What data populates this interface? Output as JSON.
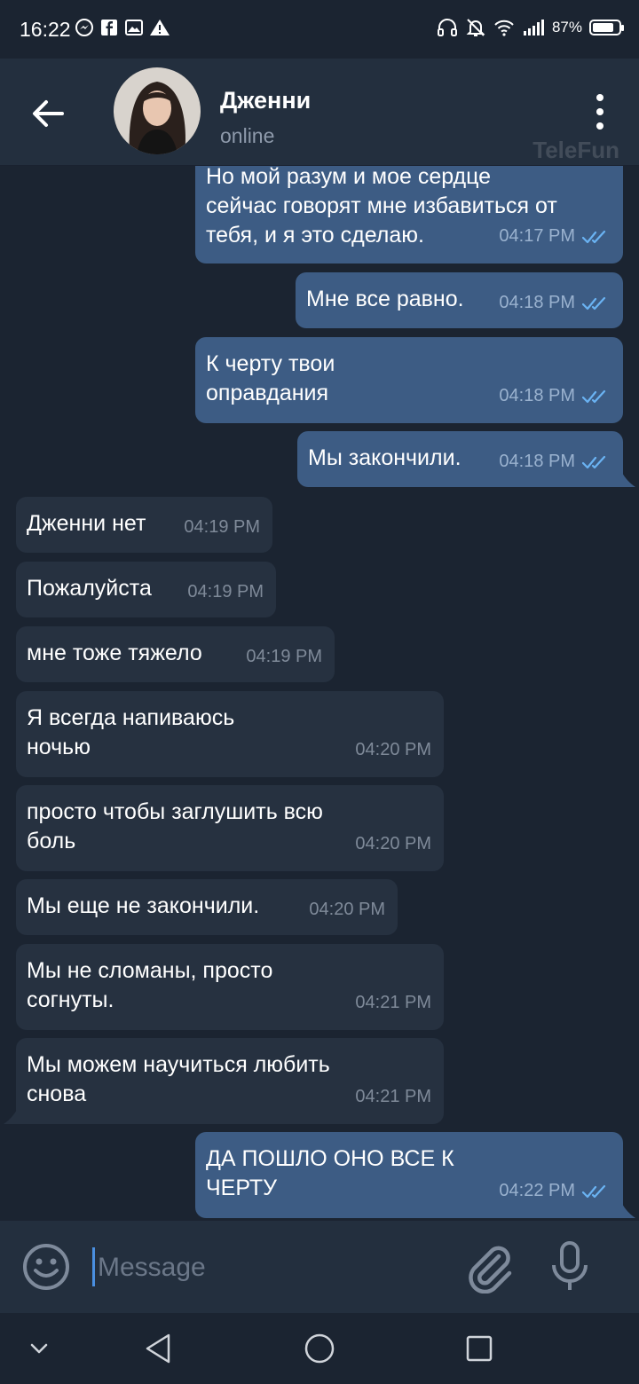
{
  "status_bar": {
    "time": "16:22",
    "battery_percent_text": "87%",
    "battery_level": 0.87,
    "left_icons": [
      "messenger-icon",
      "facebook-icon",
      "gallery-icon",
      "warning-icon"
    ],
    "right_icons": [
      "headphones-icon",
      "mute-bell-icon",
      "wifi-icon",
      "signal-icon",
      "battery-icon"
    ]
  },
  "header": {
    "contact_name": "Дженни",
    "status": "online",
    "watermark": "TeleFun"
  },
  "messages": [
    {
      "dir": "out",
      "text": "Но мой разум и мое сердце\nсейчас говорят мне избавиться от\nтебя, и я это сделаю.",
      "time": "04:17 PM"
    },
    {
      "dir": "out",
      "text": "Мне все равно.",
      "time": "04:18 PM"
    },
    {
      "dir": "out",
      "text": "К черту твои\nоправдания",
      "time": "04:18 PM"
    },
    {
      "dir": "out",
      "text": "Мы закончили.",
      "time": "04:18 PM"
    },
    {
      "dir": "in",
      "text": "Дженни нет",
      "time": "04:19 PM"
    },
    {
      "dir": "in",
      "text": "Пожалуйста",
      "time": "04:19 PM"
    },
    {
      "dir": "in",
      "text": "мне тоже тяжело",
      "time": "04:19 PM"
    },
    {
      "dir": "in",
      "text": "Я всегда напиваюсь\nночью",
      "time": "04:20 PM"
    },
    {
      "dir": "in",
      "text": "просто чтобы заглушить всю\nболь",
      "time": "04:20 PM"
    },
    {
      "dir": "in",
      "text": "Мы еще не закончили.",
      "time": "04:20 PM"
    },
    {
      "dir": "in",
      "text": "Мы не сломаны, просто\nсогнуты.",
      "time": "04:21 PM"
    },
    {
      "dir": "in",
      "text": "Мы можем научиться любить\nснова",
      "time": "04:21 PM"
    },
    {
      "dir": "out",
      "text": "ДА ПОШЛО ОНО ВСЕ К\nЧЕРТУ",
      "time": "04:22 PM"
    }
  ],
  "input": {
    "placeholder": "Message",
    "value": ""
  },
  "colors": {
    "background": "#1b2431",
    "header": "#232f3e",
    "outgoing_bubble": "#3d5c84",
    "incoming_bubble": "#263140",
    "read_checks": "#6ab3f3"
  }
}
